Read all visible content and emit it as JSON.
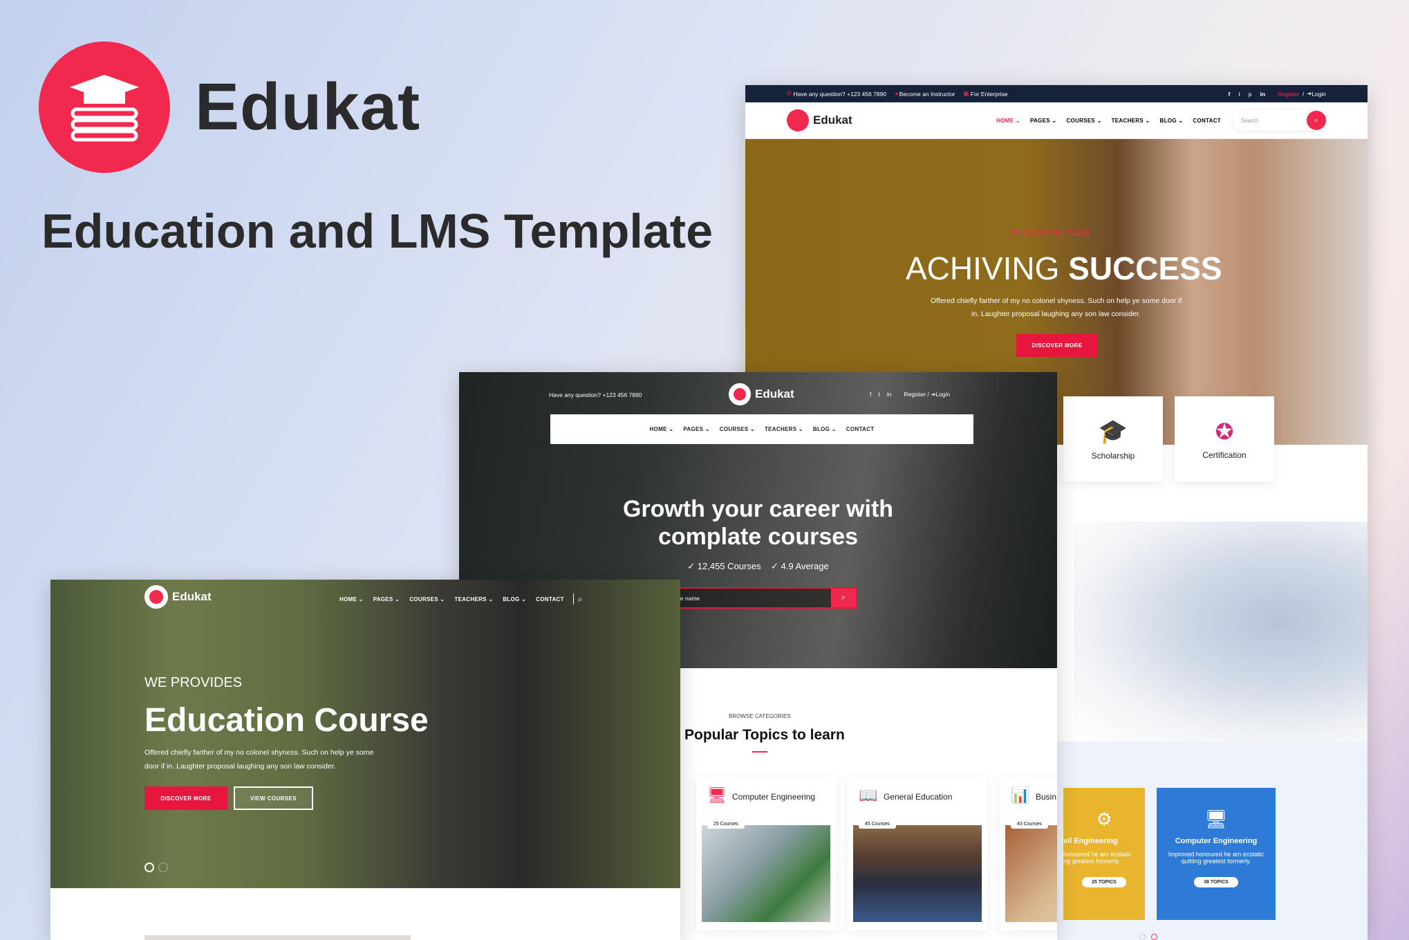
{
  "brand": {
    "name": "Edukat",
    "tagline": "Education and LMS Template",
    "accent": "#f2294f",
    "logo_icon": "books-graduation-cap-icon"
  },
  "screen1": {
    "topbar": {
      "question": "Have any question? +123 456 7890",
      "instructor": "Become an Instructor",
      "enterprise": "For Enterprise",
      "register": "Register",
      "sep": "/",
      "login": "Login",
      "socials": [
        "facebook-icon",
        "twitter-icon",
        "pinterest-icon",
        "linkedin-icon"
      ]
    },
    "logo": "Edukat",
    "nav": [
      "HOME",
      "PAGES",
      "COURSES",
      "TEACHERS",
      "BLOG",
      "CONTACT"
    ],
    "search_placeholder": "Search",
    "hero": {
      "kicker": "EDUCATION GOAL",
      "title_light": "ACHIVING",
      "title_bold": "SUCCESS",
      "text1": "Offered chiefly farther of my no colonel shyness. Such on help ye some door if",
      "text2": "in. Laughter proposal laughing any son law consider.",
      "button": "DISCOVER MORE"
    },
    "features": [
      {
        "label": "Scholarship",
        "icon": "graduation-cap-icon"
      },
      {
        "label": "Certification",
        "icon": "certificate-medal-icon"
      }
    ],
    "topics": [
      {
        "title": "vil Engineering",
        "text1": "honoured he am ecstatic",
        "text2": "ng greatest formerly.",
        "pill": "25 TOPICS",
        "color": "#e9b42e"
      },
      {
        "title": "Computer Engineering",
        "text1": "Improved honoured he am ecstatic",
        "text2": "quitting greatest formerly.",
        "pill": "38 TOPICS",
        "color": "#2d7bd6"
      }
    ]
  },
  "screen2": {
    "question": "Have any question? +123 456 7890",
    "logo": "Edukat",
    "register": "Register",
    "sep": "/",
    "login": "Login",
    "nav": [
      "HOME",
      "PAGES",
      "COURSES",
      "TEACHERS",
      "BLOG",
      "CONTACT"
    ],
    "hero": {
      "line1": "Growth your career with",
      "line2": "complate courses",
      "stat1": "✓ 12,455 Courses",
      "stat2": "✓ 4.9 Average",
      "search_placeholder": "urse name"
    },
    "section": {
      "kicker": "BROWSE CATEGORIES",
      "title": "Popular Topics to learn"
    },
    "categories": [
      {
        "name": "Computer Engineering",
        "count": "25 Courses"
      },
      {
        "name": "General Education",
        "count": "45 Courses"
      },
      {
        "name": "Busin",
        "count": "43 Courses"
      }
    ]
  },
  "screen3": {
    "logo": "Edukat",
    "nav": [
      "HOME",
      "PAGES",
      "COURSES",
      "TEACHERS",
      "BLOG",
      "CONTACT"
    ],
    "hero": {
      "kicker": "WE PROVIDES",
      "title": "Education Course",
      "text1": "Offered chiefly farther of my no colonel shyness. Such on help ye some",
      "text2": "door if in. Laughter proposal laughing any son law consider.",
      "btn1": "DISCOVER MORE",
      "btn2": "VIEW COURSES"
    }
  }
}
